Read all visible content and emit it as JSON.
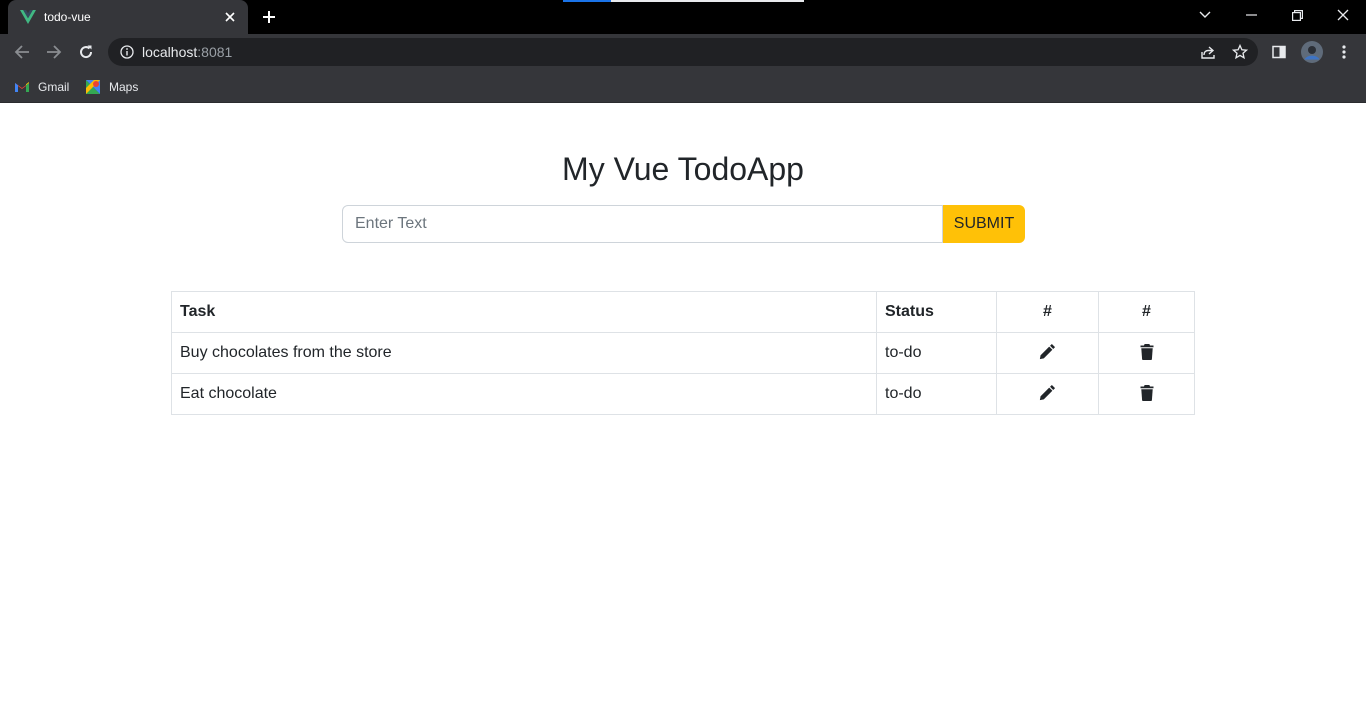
{
  "browser": {
    "tab_title": "todo-vue",
    "url_host": "localhost",
    "url_port": ":8081",
    "bookmarks": [
      {
        "label": "Gmail",
        "icon": "gmail-icon"
      },
      {
        "label": "Maps",
        "icon": "maps-icon"
      }
    ]
  },
  "app": {
    "title": "My Vue TodoApp",
    "input_placeholder": "Enter Text",
    "input_value": "",
    "submit_label": "SUBMIT",
    "submit_color": "#ffc107",
    "table": {
      "headers": [
        "Task",
        "Status",
        "#",
        "#"
      ],
      "rows": [
        {
          "task": "Buy chocolates from the store",
          "status": "to-do",
          "edit_icon": "pencil-icon",
          "delete_icon": "trash-icon"
        },
        {
          "task": "Eat chocolate",
          "status": "to-do",
          "edit_icon": "pencil-icon",
          "delete_icon": "trash-icon"
        }
      ]
    }
  }
}
